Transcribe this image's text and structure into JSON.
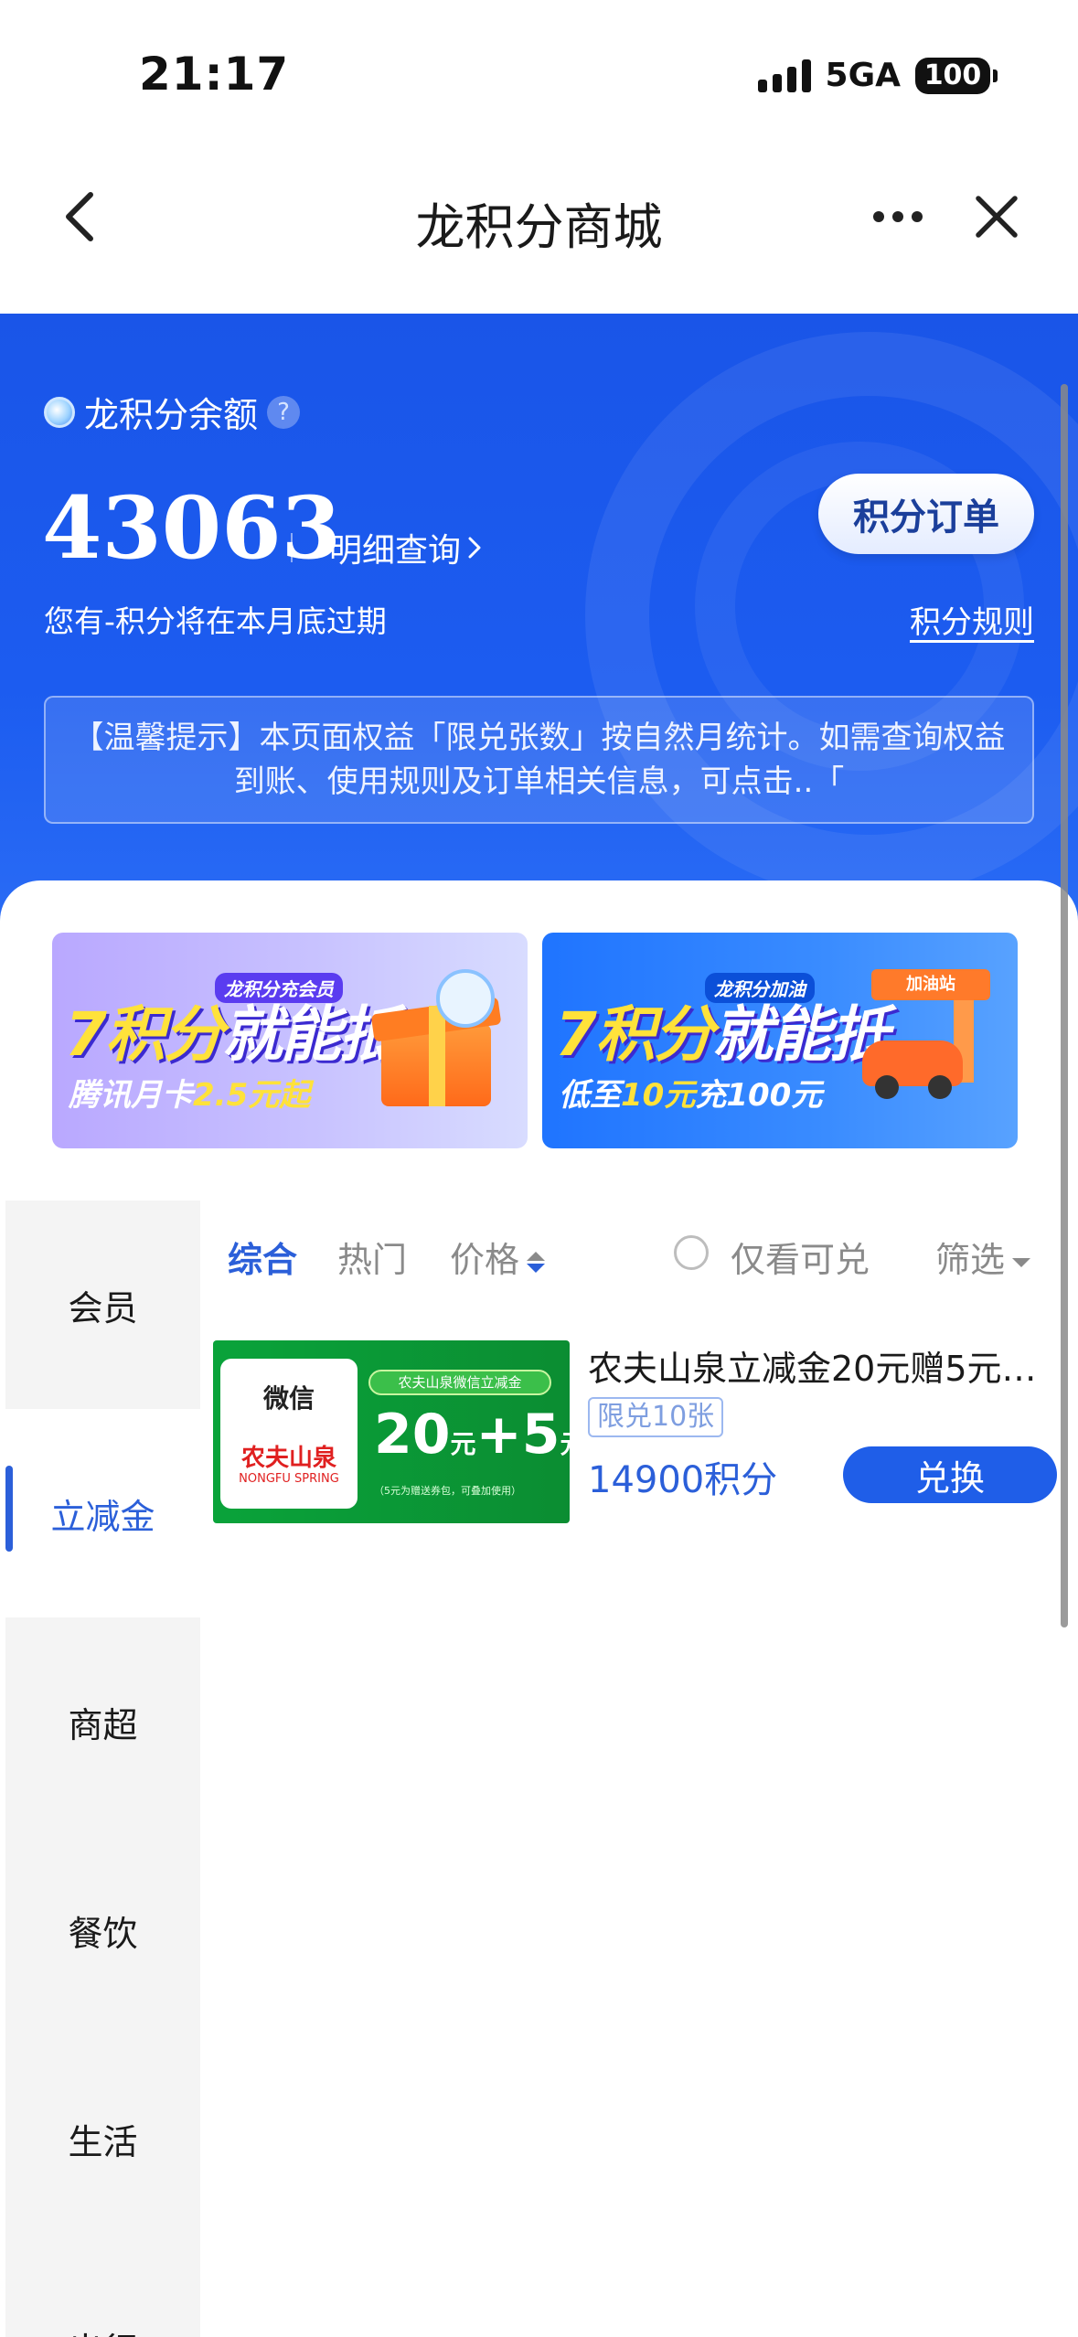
{
  "status_bar": {
    "time": "21:17",
    "network": "5GA",
    "battery": "100"
  },
  "nav": {
    "title": "龙积分商城",
    "back_icon": "chevron-left-icon",
    "more_icon": "more-icon",
    "close_icon": "close-icon"
  },
  "header": {
    "balance_label": "龙积分余额",
    "help_glyph": "?",
    "balance_value": "43063",
    "detail_link": "明细查询",
    "order_button": "积分订单",
    "expire_text": "您有-积分将在本月底过期",
    "rules_link": "积分规则",
    "notice": "【温馨提示】本页面权益「限兑张数」按自然月统计。如需查询权益到账、使用规则及订单相关信息，可点击..「"
  },
  "banners": [
    {
      "big_num": "7积分",
      "big_text": "就能抵",
      "tag": "龙积分充会员",
      "sub_prefix": "腾讯月卡",
      "sub_highlight": "2.5元起",
      "sub_suffix": ""
    },
    {
      "big_num": "7积分",
      "big_text": "就能抵",
      "tag": "龙积分加油",
      "sub_prefix": "低至",
      "sub_highlight": "10元",
      "sub_suffix": "充100元",
      "station_label": "加油站"
    }
  ],
  "categories": [
    {
      "label": "会员",
      "active": false
    },
    {
      "label": "立减金",
      "active": true
    },
    {
      "label": "商超",
      "active": false
    },
    {
      "label": "餐饮",
      "active": false
    },
    {
      "label": "生活",
      "active": false
    },
    {
      "label": "出行",
      "active": false
    }
  ],
  "filters": {
    "comprehensive": "综合",
    "hot": "热门",
    "price": "价格",
    "only_redeemable": "仅看可兑",
    "filter": "筛选"
  },
  "products": [
    {
      "image": {
        "wechat": "微信",
        "brand": "农夫山泉",
        "brand_en": "NONGFU SPRING",
        "header": "农夫山泉微信立减金",
        "amount_main": "20",
        "amount_main_unit": "元",
        "amount_plus": "+5",
        "amount_plus_unit": "元",
        "footnote": "（5元为赠送券包，可叠加使用）"
      },
      "title": "农夫山泉立减金20元赠5元…",
      "limit": "限兑10张",
      "price": "14900积分",
      "redeem_label": "兑换"
    }
  ],
  "colors": {
    "brand_blue": "#1c5cf0",
    "accent_blue": "#2b5fd9",
    "button_blue": "#1f5ee8"
  }
}
